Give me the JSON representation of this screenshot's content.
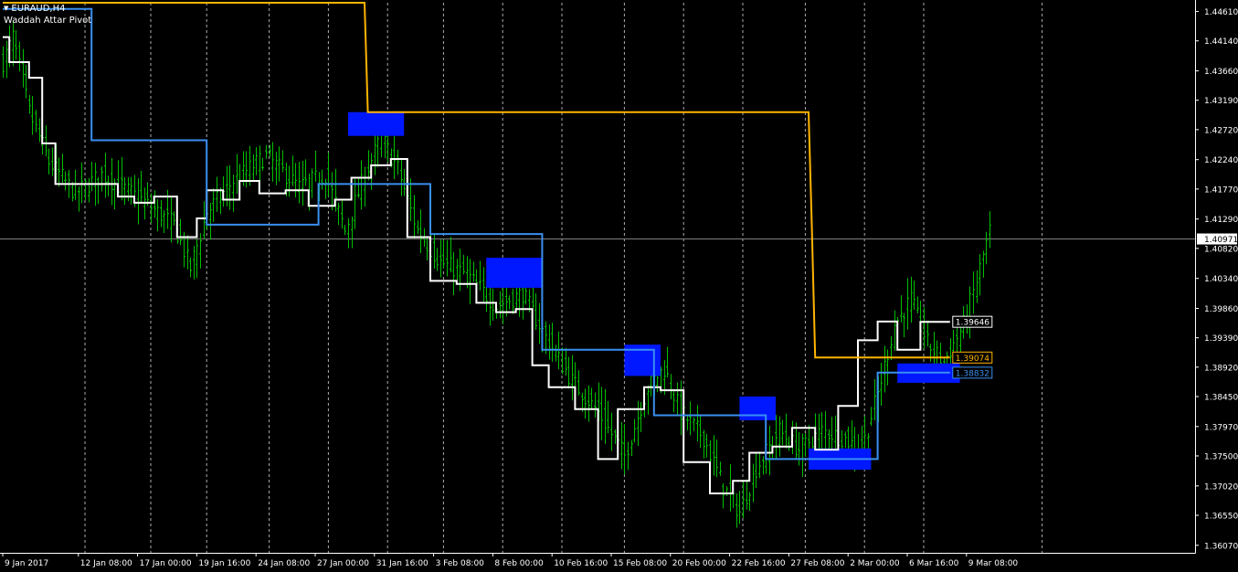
{
  "window": {
    "symbol_label": "EURAUD,H4",
    "indicator_label": "Waddah Attar Pivot"
  },
  "colors": {
    "background": "#000000",
    "candle": "#00c000",
    "pivot_line": "#ffffff",
    "blue_line": "#3a8ff0",
    "orange_line": "#ffb400",
    "zone_fill": "#0018ff",
    "grid": "#c0c0c0",
    "axis_text": "#ffffff",
    "current_price_line": "#808080"
  },
  "chart_data": {
    "type": "line",
    "title": "",
    "xlabel": "",
    "ylabel": "",
    "ylim": [
      1.3595,
      1.4475
    ],
    "grid": true,
    "x_range": [
      0,
      300
    ],
    "y_ticks": [
      "1.44610",
      "1.44140",
      "1.43660",
      "1.43190",
      "1.42720",
      "1.42240",
      "1.41770",
      "1.41290",
      "1.40820",
      "1.40340",
      "1.39860",
      "1.39390",
      "1.38920",
      "1.38450",
      "1.37970",
      "1.37500",
      "1.37020",
      "1.36550",
      "1.36070"
    ],
    "x_ticks": [
      {
        "x": 0,
        "label": "9 Jan 2017"
      },
      {
        "x": 23,
        "label": "12 Jan 08:00"
      },
      {
        "x": 41,
        "label": "17 Jan 00:00"
      },
      {
        "x": 59,
        "label": "19 Jan 16:00"
      },
      {
        "x": 77,
        "label": "24 Jan 08:00"
      },
      {
        "x": 95,
        "label": "27 Jan 00:00"
      },
      {
        "x": 113,
        "label": "31 Jan 16:00"
      },
      {
        "x": 131,
        "label": "3 Feb 08:00"
      },
      {
        "x": 149,
        "label": "8 Feb 00:00"
      },
      {
        "x": 167,
        "label": "10 Feb 16:00"
      },
      {
        "x": 185,
        "label": "15 Feb 08:00"
      },
      {
        "x": 203,
        "label": "20 Feb 00:00"
      },
      {
        "x": 221,
        "label": "22 Feb 16:00"
      },
      {
        "x": 239,
        "label": "27 Feb 08:00"
      },
      {
        "x": 257,
        "label": "2 Mar 00:00"
      },
      {
        "x": 275,
        "label": "6 Mar 16:00"
      },
      {
        "x": 293,
        "label": "9 Mar 08:00"
      }
    ],
    "vgrid_x": [
      25,
      45,
      62,
      81,
      99,
      117,
      134,
      152,
      170,
      189,
      207,
      225,
      244,
      262,
      280,
      316
    ],
    "current_price": {
      "value": 1.40971,
      "label": "1.40971"
    },
    "price_path_anchors": [
      {
        "x": 0,
        "y": 1.438
      },
      {
        "x": 3,
        "y": 1.442
      },
      {
        "x": 8,
        "y": 1.43
      },
      {
        "x": 14,
        "y": 1.422
      },
      {
        "x": 22,
        "y": 1.417
      },
      {
        "x": 30,
        "y": 1.42
      },
      {
        "x": 42,
        "y": 1.416
      },
      {
        "x": 52,
        "y": 1.412
      },
      {
        "x": 57,
        "y": 1.405
      },
      {
        "x": 62,
        "y": 1.414
      },
      {
        "x": 70,
        "y": 1.419
      },
      {
        "x": 80,
        "y": 1.423
      },
      {
        "x": 90,
        "y": 1.418
      },
      {
        "x": 98,
        "y": 1.42
      },
      {
        "x": 104,
        "y": 1.411
      },
      {
        "x": 110,
        "y": 1.42
      },
      {
        "x": 115,
        "y": 1.426
      },
      {
        "x": 120,
        "y": 1.421
      },
      {
        "x": 126,
        "y": 1.411
      },
      {
        "x": 133,
        "y": 1.406
      },
      {
        "x": 141,
        "y": 1.404
      },
      {
        "x": 150,
        "y": 1.399
      },
      {
        "x": 158,
        "y": 1.401
      },
      {
        "x": 165,
        "y": 1.394
      },
      {
        "x": 173,
        "y": 1.387
      },
      {
        "x": 181,
        "y": 1.382
      },
      {
        "x": 189,
        "y": 1.375
      },
      {
        "x": 196,
        "y": 1.386
      },
      {
        "x": 201,
        "y": 1.389
      },
      {
        "x": 206,
        "y": 1.382
      },
      {
        "x": 213,
        "y": 1.378
      },
      {
        "x": 219,
        "y": 1.37
      },
      {
        "x": 224,
        "y": 1.366
      },
      {
        "x": 229,
        "y": 1.373
      },
      {
        "x": 236,
        "y": 1.379
      },
      {
        "x": 242,
        "y": 1.376
      },
      {
        "x": 249,
        "y": 1.379
      },
      {
        "x": 255,
        "y": 1.378
      },
      {
        "x": 261,
        "y": 1.376
      },
      {
        "x": 266,
        "y": 1.385
      },
      {
        "x": 271,
        "y": 1.396
      },
      {
        "x": 276,
        "y": 1.4
      },
      {
        "x": 281,
        "y": 1.393
      },
      {
        "x": 286,
        "y": 1.39
      },
      {
        "x": 292,
        "y": 1.396
      },
      {
        "x": 296,
        "y": 1.403
      },
      {
        "x": 300,
        "y": 1.411
      }
    ],
    "series": [
      {
        "name": "",
        "color": "#ffffff",
        "points": [
          {
            "x": 0,
            "y": 1.442
          },
          {
            "x": 2,
            "y": 1.442
          },
          {
            "x": 2,
            "y": 1.438
          },
          {
            "x": 8,
            "y": 1.438
          },
          {
            "x": 8,
            "y": 1.4355
          },
          {
            "x": 12,
            "y": 1.4355
          },
          {
            "x": 12,
            "y": 1.425
          },
          {
            "x": 16,
            "y": 1.425
          },
          {
            "x": 16,
            "y": 1.4185
          },
          {
            "x": 35,
            "y": 1.4185
          },
          {
            "x": 35,
            "y": 1.4165
          },
          {
            "x": 40,
            "y": 1.4165
          },
          {
            "x": 40,
            "y": 1.4155
          },
          {
            "x": 46,
            "y": 1.4155
          },
          {
            "x": 46,
            "y": 1.4165
          },
          {
            "x": 53,
            "y": 1.4165
          },
          {
            "x": 53,
            "y": 1.41
          },
          {
            "x": 59,
            "y": 1.41
          },
          {
            "x": 59,
            "y": 1.413
          },
          {
            "x": 62,
            "y": 1.413
          },
          {
            "x": 62,
            "y": 1.4175
          },
          {
            "x": 67,
            "y": 1.4175
          },
          {
            "x": 67,
            "y": 1.416
          },
          {
            "x": 72,
            "y": 1.416
          },
          {
            "x": 72,
            "y": 1.419
          },
          {
            "x": 78,
            "y": 1.419
          },
          {
            "x": 78,
            "y": 1.417
          },
          {
            "x": 86,
            "y": 1.417
          },
          {
            "x": 86,
            "y": 1.4175
          },
          {
            "x": 93,
            "y": 1.4175
          },
          {
            "x": 93,
            "y": 1.415
          },
          {
            "x": 101,
            "y": 1.415
          },
          {
            "x": 101,
            "y": 1.416
          },
          {
            "x": 106,
            "y": 1.416
          },
          {
            "x": 106,
            "y": 1.4195
          },
          {
            "x": 112,
            "y": 1.4195
          },
          {
            "x": 112,
            "y": 1.4215
          },
          {
            "x": 118,
            "y": 1.4215
          },
          {
            "x": 118,
            "y": 1.4225
          },
          {
            "x": 123,
            "y": 1.4225
          },
          {
            "x": 123,
            "y": 1.41
          },
          {
            "x": 130,
            "y": 1.41
          },
          {
            "x": 130,
            "y": 1.403
          },
          {
            "x": 138,
            "y": 1.403
          },
          {
            "x": 138,
            "y": 1.4025
          },
          {
            "x": 144,
            "y": 1.4025
          },
          {
            "x": 144,
            "y": 1.3995
          },
          {
            "x": 150,
            "y": 1.3995
          },
          {
            "x": 150,
            "y": 1.398
          },
          {
            "x": 156,
            "y": 1.398
          },
          {
            "x": 156,
            "y": 1.3985
          },
          {
            "x": 161,
            "y": 1.3985
          },
          {
            "x": 161,
            "y": 1.3895
          },
          {
            "x": 166,
            "y": 1.3895
          },
          {
            "x": 166,
            "y": 1.386
          },
          {
            "x": 174,
            "y": 1.386
          },
          {
            "x": 174,
            "y": 1.3825
          },
          {
            "x": 181,
            "y": 1.3825
          },
          {
            "x": 181,
            "y": 1.3745
          },
          {
            "x": 187,
            "y": 1.3745
          },
          {
            "x": 187,
            "y": 1.3825
          },
          {
            "x": 195,
            "y": 1.3825
          },
          {
            "x": 195,
            "y": 1.386
          },
          {
            "x": 200,
            "y": 1.386
          },
          {
            "x": 200,
            "y": 1.3855
          },
          {
            "x": 207,
            "y": 1.3855
          },
          {
            "x": 207,
            "y": 1.374
          },
          {
            "x": 215,
            "y": 1.374
          },
          {
            "x": 215,
            "y": 1.369
          },
          {
            "x": 222,
            "y": 1.369
          },
          {
            "x": 222,
            "y": 1.371
          },
          {
            "x": 227,
            "y": 1.371
          },
          {
            "x": 227,
            "y": 1.3755
          },
          {
            "x": 234,
            "y": 1.3755
          },
          {
            "x": 234,
            "y": 1.3765
          },
          {
            "x": 240,
            "y": 1.3765
          },
          {
            "x": 240,
            "y": 1.3795
          },
          {
            "x": 247,
            "y": 1.3795
          },
          {
            "x": 247,
            "y": 1.376
          },
          {
            "x": 254,
            "y": 1.376
          },
          {
            "x": 254,
            "y": 1.383
          },
          {
            "x": 260,
            "y": 1.383
          },
          {
            "x": 260,
            "y": 1.3935
          },
          {
            "x": 266,
            "y": 1.3935
          },
          {
            "x": 266,
            "y": 1.3965
          },
          {
            "x": 272,
            "y": 1.3965
          },
          {
            "x": 272,
            "y": 1.392
          },
          {
            "x": 279,
            "y": 1.392
          },
          {
            "x": 279,
            "y": 1.39646
          },
          {
            "x": 288,
            "y": 1.39646
          }
        ]
      },
      {
        "name": "",
        "color": "#3a8ff0",
        "points": [
          {
            "x": 0,
            "y": 1.4465
          },
          {
            "x": 27,
            "y": 1.4465
          },
          {
            "x": 27,
            "y": 1.4255
          },
          {
            "x": 62,
            "y": 1.4255
          },
          {
            "x": 62,
            "y": 1.412
          },
          {
            "x": 96,
            "y": 1.412
          },
          {
            "x": 96,
            "y": 1.4185
          },
          {
            "x": 130,
            "y": 1.4185
          },
          {
            "x": 130,
            "y": 1.4105
          },
          {
            "x": 164,
            "y": 1.4105
          },
          {
            "x": 164,
            "y": 1.392
          },
          {
            "x": 198,
            "y": 1.392
          },
          {
            "x": 198,
            "y": 1.3815
          },
          {
            "x": 232,
            "y": 1.3815
          },
          {
            "x": 232,
            "y": 1.3745
          },
          {
            "x": 266,
            "y": 1.3745
          },
          {
            "x": 266,
            "y": 1.38832
          },
          {
            "x": 288,
            "y": 1.38832
          }
        ]
      },
      {
        "name": "",
        "color": "#ffb400",
        "points": [
          {
            "x": 0,
            "y": 1.4475
          },
          {
            "x": 110,
            "y": 1.4475
          },
          {
            "x": 111,
            "y": 1.43
          },
          {
            "x": 245,
            "y": 1.43
          },
          {
            "x": 246,
            "y": 1.4115
          },
          {
            "x": 247,
            "y": 1.39074
          },
          {
            "x": 288,
            "y": 1.39074
          }
        ]
      }
    ],
    "labels": [
      {
        "value": 1.39646,
        "text": "1.39646",
        "color": "#ffffff"
      },
      {
        "value": 1.39074,
        "text": "1.39074",
        "color": "#ffb400"
      },
      {
        "value": 1.38832,
        "text": "1.38832",
        "color": "#3a8ff0"
      }
    ],
    "zones": [
      {
        "x0": 105,
        "x1": 122,
        "y0": 1.4262,
        "y1": 1.43
      },
      {
        "x0": 147,
        "x1": 164,
        "y0": 1.4019,
        "y1": 1.4067
      },
      {
        "x0": 189,
        "x1": 200,
        "y0": 1.3878,
        "y1": 1.3928
      },
      {
        "x0": 224,
        "x1": 235,
        "y0": 1.3807,
        "y1": 1.3845
      },
      {
        "x0": 245,
        "x1": 264,
        "y0": 1.3728,
        "y1": 1.3762
      },
      {
        "x0": 272,
        "x1": 291,
        "y0": 1.3867,
        "y1": 1.3898
      }
    ]
  }
}
